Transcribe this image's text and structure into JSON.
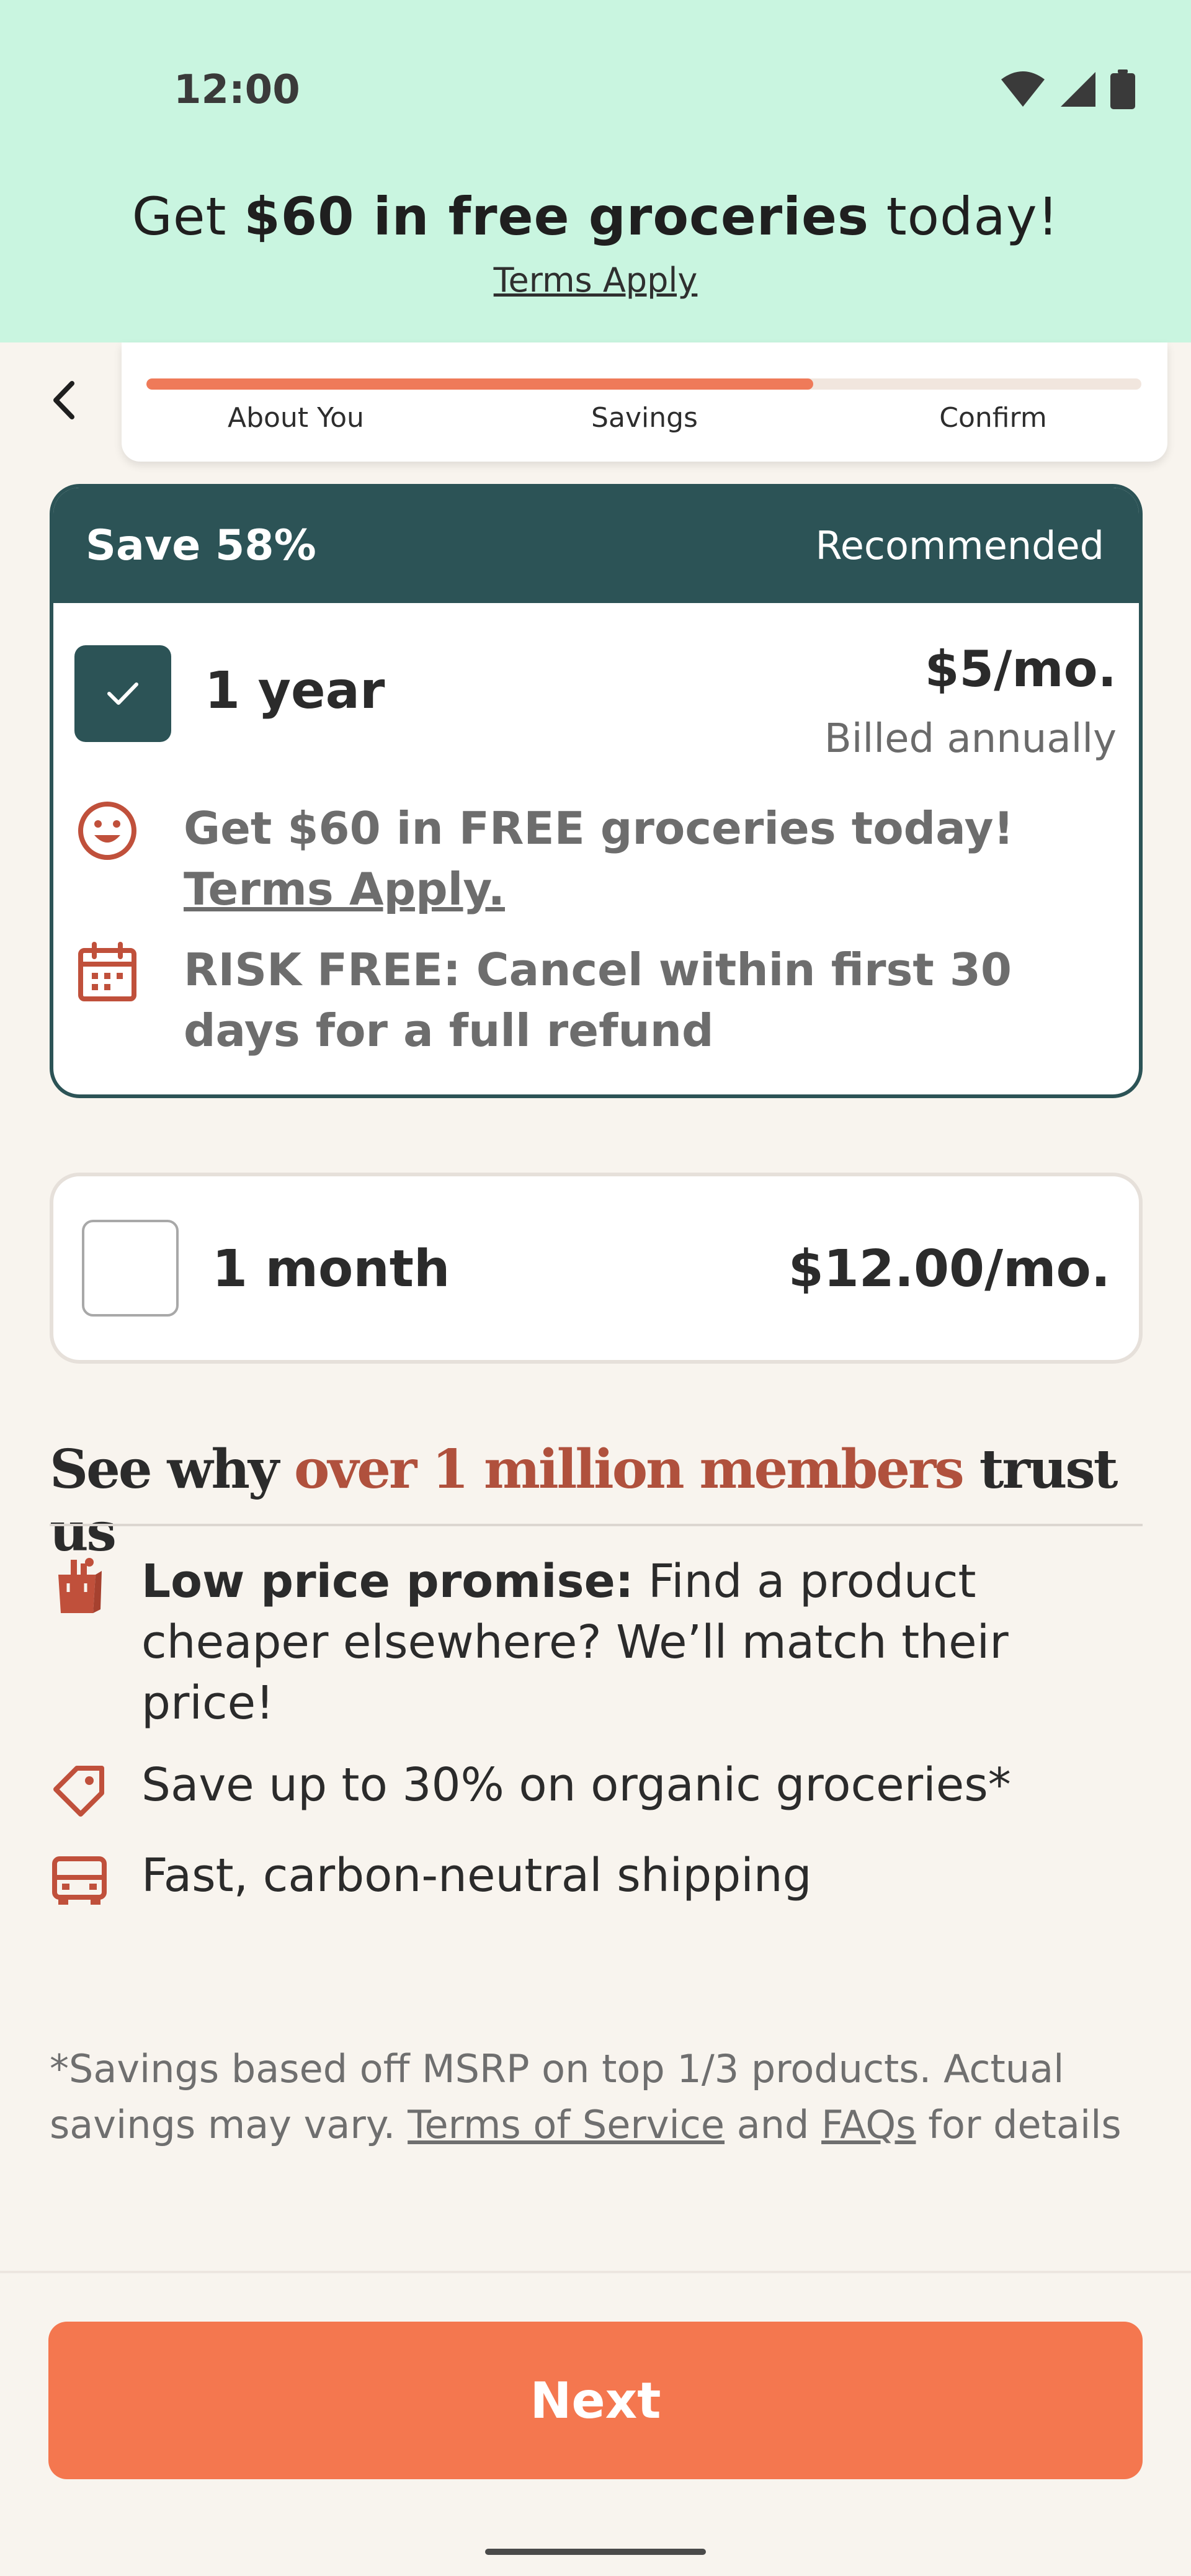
{
  "status_bar": {
    "time": "12:00"
  },
  "promo": {
    "title_prefix": "Get ",
    "title_bold": "$60 in free groceries",
    "title_suffix": " today!",
    "terms": "Terms Apply"
  },
  "progress": {
    "fraction": 0.67,
    "steps": [
      "About You",
      "Savings",
      "Confirm"
    ]
  },
  "plans": [
    {
      "badge": "Save 58%",
      "tag": "Recommended",
      "term": "1 year",
      "price": "$5/mo.",
      "billing": "Billed annually",
      "selected": true,
      "perks": [
        {
          "icon": "smiley-icon",
          "text": "Get $60 in FREE groceries today!",
          "link": "Terms Apply."
        },
        {
          "icon": "calendar-icon",
          "text": "RISK FREE: Cancel within first 30 days for a full refund"
        }
      ]
    },
    {
      "term": "1 month",
      "price": "$12.00/mo.",
      "selected": false
    }
  ],
  "trust": {
    "title_prefix": "See why ",
    "title_highlight": "over 1 million members",
    "title_suffix": " trust us",
    "items": [
      {
        "icon": "grocery-bag-icon",
        "bold": "Low price promise:",
        "text": " Find a product cheaper elsewhere? We’ll match their price!"
      },
      {
        "icon": "price-tag-icon",
        "text": "Save up to 30% on organic groceries*"
      },
      {
        "icon": "truck-icon",
        "text": "Fast, carbon-neutral shipping"
      }
    ]
  },
  "footnote": {
    "text": "*Savings based off MSRP on top 1/3 products. Actual savings may vary. ",
    "link_tos": "Terms of Service",
    "and": " and ",
    "link_faq": "FAQs",
    "suffix": " for details"
  },
  "cta": {
    "label": "Next"
  },
  "colors": {
    "promo_bg": "#c9f5e0",
    "accent_orange": "#f4774f",
    "dark_teal": "#2c5356",
    "highlight_red": "#b0513d",
    "page_bg": "#f8f4ee"
  }
}
